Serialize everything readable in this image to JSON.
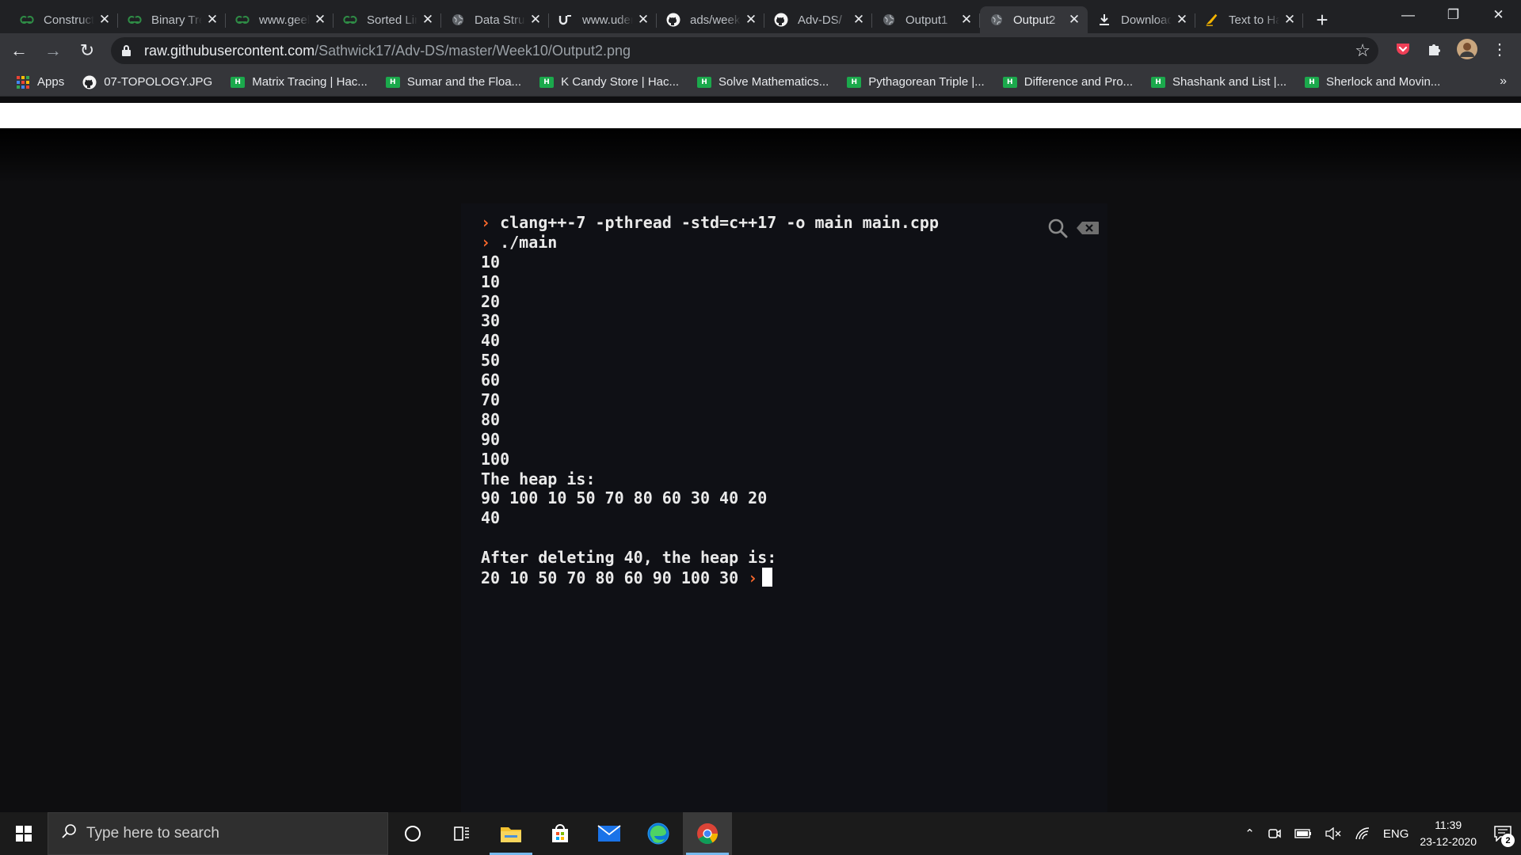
{
  "tabs": [
    {
      "title": "Construct",
      "icon": "geeksforgeeks-icon",
      "active": false
    },
    {
      "title": "Binary Tree",
      "icon": "geeksforgeeks-icon",
      "active": false
    },
    {
      "title": "www.geeksforgeeks",
      "icon": "geeksforgeeks-icon",
      "active": false
    },
    {
      "title": "Sorted Linked",
      "icon": "geeksforgeeks-icon",
      "active": false
    },
    {
      "title": "Data Structures",
      "icon": "globe-icon",
      "active": false
    },
    {
      "title": "www.udemy",
      "icon": "udemy-icon",
      "active": false
    },
    {
      "title": "ads/week",
      "icon": "github-icon",
      "active": false
    },
    {
      "title": "Adv-DS/",
      "icon": "github-icon",
      "active": false
    },
    {
      "title": "Output1",
      "icon": "globe-icon",
      "active": false
    },
    {
      "title": "Output2",
      "icon": "globe-icon",
      "active": true
    },
    {
      "title": "Downloads",
      "icon": "download-icon",
      "active": false
    },
    {
      "title": "Text to Handwriting",
      "icon": "handwriting-icon",
      "active": false
    }
  ],
  "address": {
    "host": "raw.githubusercontent.com",
    "path": "/Sathwick17/Adv-DS/master/Week10/Output2.png"
  },
  "bookmarks": [
    {
      "label": "Apps",
      "icon": "apps-grid-icon"
    },
    {
      "label": "07-TOPOLOGY.JPG",
      "icon": "github-icon"
    },
    {
      "label": "Matrix Tracing | Hac...",
      "icon": "hackerrank-icon"
    },
    {
      "label": "Sumar and the Floa...",
      "icon": "hackerrank-icon"
    },
    {
      "label": "K Candy Store | Hac...",
      "icon": "hackerrank-icon"
    },
    {
      "label": "Solve Mathematics...",
      "icon": "hackerrank-icon"
    },
    {
      "label": "Pythagorean Triple |...",
      "icon": "hackerrank-icon"
    },
    {
      "label": "Difference and Pro...",
      "icon": "hackerrank-icon"
    },
    {
      "label": "Shashank and List |...",
      "icon": "hackerrank-icon"
    },
    {
      "label": "Sherlock and Movin...",
      "icon": "hackerrank-icon"
    }
  ],
  "terminal": {
    "prompt_symbol": "›",
    "commands": [
      "clang++-7 -pthread -std=c++17 -o main main.cpp",
      "./main"
    ],
    "output": [
      "10",
      "10",
      "20",
      "30",
      "40",
      "50",
      "60",
      "70",
      "80",
      "90",
      "100",
      "The heap is:",
      "90 100 10 50 70 80 60 30 40 20",
      "40",
      "",
      "After deleting 40, the heap is:"
    ],
    "last_line": "20 10 50 70 80 60 90 100 30"
  },
  "taskbar": {
    "search_placeholder": "Type here to search",
    "language": "ENG",
    "time": "11:39",
    "date": "23-12-2020",
    "notification_count": "2"
  },
  "colors": {
    "prompt": "#ff6a2c",
    "terminal_bg": "#0f1015",
    "chrome_frame": "#202124",
    "chrome_toolbar": "#35363a"
  }
}
